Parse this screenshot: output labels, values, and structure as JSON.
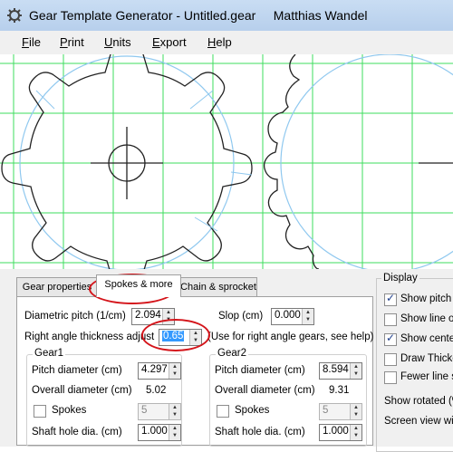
{
  "window": {
    "title": "Gear Template Generator - Untitled.gear     Matthias Wandel"
  },
  "menu": [
    {
      "label_u": "F",
      "label_rest": "ile"
    },
    {
      "label_u": "P",
      "label_rest": "rint"
    },
    {
      "label_u": "U",
      "label_rest": "nits"
    },
    {
      "label_u": "E",
      "label_rest": "xport"
    },
    {
      "label_u": "H",
      "label_rest": "elp"
    }
  ],
  "tabs": {
    "gear_properties": "Gear properties",
    "spokes_more": "Spokes & more",
    "chain_sprocket": "Chain & sprocket"
  },
  "form": {
    "diametric_pitch_label": "Diametric pitch  (1/cm)",
    "diametric_pitch_value": "2.094",
    "slop_label": "Slop (cm)",
    "slop_value": "0.000",
    "right_angle_label": "Right angle thickness adjust",
    "right_angle_value": "0.65",
    "right_angle_note": "(Use for right angle gears, see help)"
  },
  "gear1": {
    "title": "Gear1",
    "pitch_label": "Pitch diameter (cm)",
    "pitch_value": "4.297",
    "overall_label": "Overall diameter (cm)",
    "overall_value": "5.02",
    "spokes_label": "Spokes",
    "spokes_value": "5",
    "shaft_label": "Shaft hole dia. (cm)",
    "shaft_value": "1.000"
  },
  "gear2": {
    "title": "Gear2",
    "pitch_label": "Pitch diameter (cm)",
    "pitch_value": "8.594",
    "overall_label": "Overall diameter (cm)",
    "overall_value": "9.31",
    "spokes_label": "Spokes",
    "spokes_value": "5",
    "shaft_label": "Shaft hole dia. (cm)",
    "shaft_value": "1.000"
  },
  "display": {
    "title": "Display",
    "show_pitch": "Show pitch c",
    "show_line": "Show line of",
    "show_center": "Show center",
    "draw_thick": "Draw Thicke",
    "fewer_lines": "Fewer line se",
    "show_rotated": "Show rotated (%",
    "screen_view": "Screen view wid"
  },
  "colors": {
    "grid": "#3ddc5e",
    "pitch_circle": "#8fc8ef",
    "annotation": "#d4141a"
  }
}
